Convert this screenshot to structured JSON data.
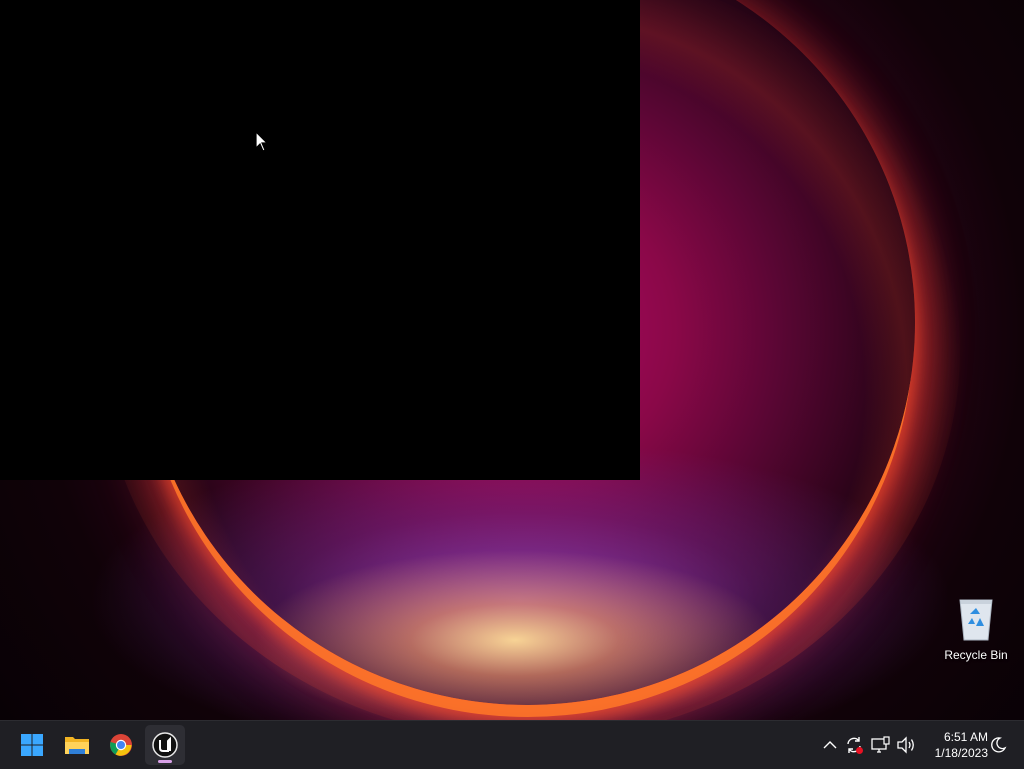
{
  "desktop": {
    "icons": [
      {
        "label": "Recycle Bin",
        "icon": "recycle-bin-icon"
      }
    ]
  },
  "taskbar": {
    "pinned": [
      {
        "name": "Start",
        "icon": "windows-start-icon"
      },
      {
        "name": "File Explorer",
        "icon": "file-explorer-icon"
      },
      {
        "name": "Google Chrome",
        "icon": "chrome-icon"
      },
      {
        "name": "Unreal Engine",
        "icon": "unreal-engine-icon",
        "active": true
      }
    ],
    "tray": {
      "icons": [
        "show-hidden-icons-chevron",
        "sync-status-icon",
        "network-icon",
        "volume-icon",
        "focus-moon-icon"
      ],
      "time": "6:51 AM",
      "date": "1/18/2023"
    }
  },
  "colors": {
    "taskbar_bg": "#1f1f24",
    "accent": "#d9a1e8",
    "window_bg": "#000000"
  }
}
